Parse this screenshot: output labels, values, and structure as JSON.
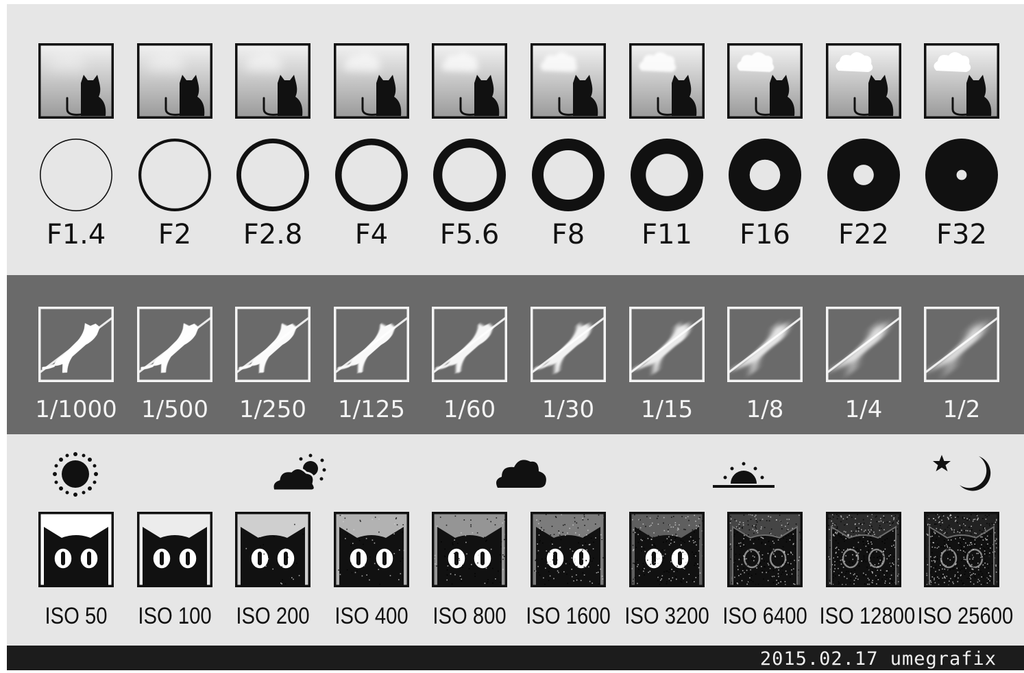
{
  "aperture": {
    "stops": [
      {
        "label": "F1.4",
        "ring": 0.03,
        "cloud": 0.0
      },
      {
        "label": "F2",
        "ring": 0.08,
        "cloud": 0.12
      },
      {
        "label": "F2.8",
        "ring": 0.13,
        "cloud": 0.25
      },
      {
        "label": "F4",
        "ring": 0.18,
        "cloud": 0.4
      },
      {
        "label": "F5.6",
        "ring": 0.25,
        "cloud": 0.55
      },
      {
        "label": "F8",
        "ring": 0.32,
        "cloud": 0.7
      },
      {
        "label": "F11",
        "ring": 0.42,
        "cloud": 0.82
      },
      {
        "label": "F16",
        "ring": 0.58,
        "cloud": 0.92
      },
      {
        "label": "F22",
        "ring": 0.72,
        "cloud": 1.0
      },
      {
        "label": "F32",
        "ring": 0.86,
        "cloud": 1.0
      }
    ]
  },
  "shutter": {
    "speeds": [
      {
        "label": "1/1000",
        "blur": 0.0
      },
      {
        "label": "1/500",
        "blur": 0.05
      },
      {
        "label": "1/250",
        "blur": 0.1
      },
      {
        "label": "1/125",
        "blur": 0.15
      },
      {
        "label": "1/60",
        "blur": 0.22
      },
      {
        "label": "1/30",
        "blur": 0.35
      },
      {
        "label": "1/15",
        "blur": 0.5
      },
      {
        "label": "1/8",
        "blur": 0.7
      },
      {
        "label": "1/4",
        "blur": 0.88
      },
      {
        "label": "1/2",
        "blur": 1.0
      }
    ]
  },
  "iso": {
    "values": [
      {
        "label": "ISO 50",
        "bg": "#ffffff",
        "noise": 0.0
      },
      {
        "label": "ISO 100",
        "bg": "#ececec",
        "noise": 0.0
      },
      {
        "label": "ISO 200",
        "bg": "#cfcfcf",
        "noise": 0.03
      },
      {
        "label": "ISO 400",
        "bg": "#b2b2b2",
        "noise": 0.06
      },
      {
        "label": "ISO 800",
        "bg": "#959595",
        "noise": 0.1
      },
      {
        "label": "ISO 1600",
        "bg": "#7c7c7c",
        "noise": 0.16
      },
      {
        "label": "ISO 3200",
        "bg": "#5f5f5f",
        "noise": 0.24
      },
      {
        "label": "ISO 6400",
        "bg": "#454545",
        "noise": 0.34
      },
      {
        "label": "ISO 12800",
        "bg": "#2d2d2d",
        "noise": 0.45
      },
      {
        "label": "ISO 25600",
        "bg": "#222222",
        "noise": 0.55
      }
    ],
    "lighting_icons": [
      "sun-icon",
      "partly-cloudy-icon",
      "cloud-icon",
      "sunset-icon",
      "night-icon"
    ]
  },
  "footer": {
    "credit": "2015.02.17 umegrafix"
  }
}
